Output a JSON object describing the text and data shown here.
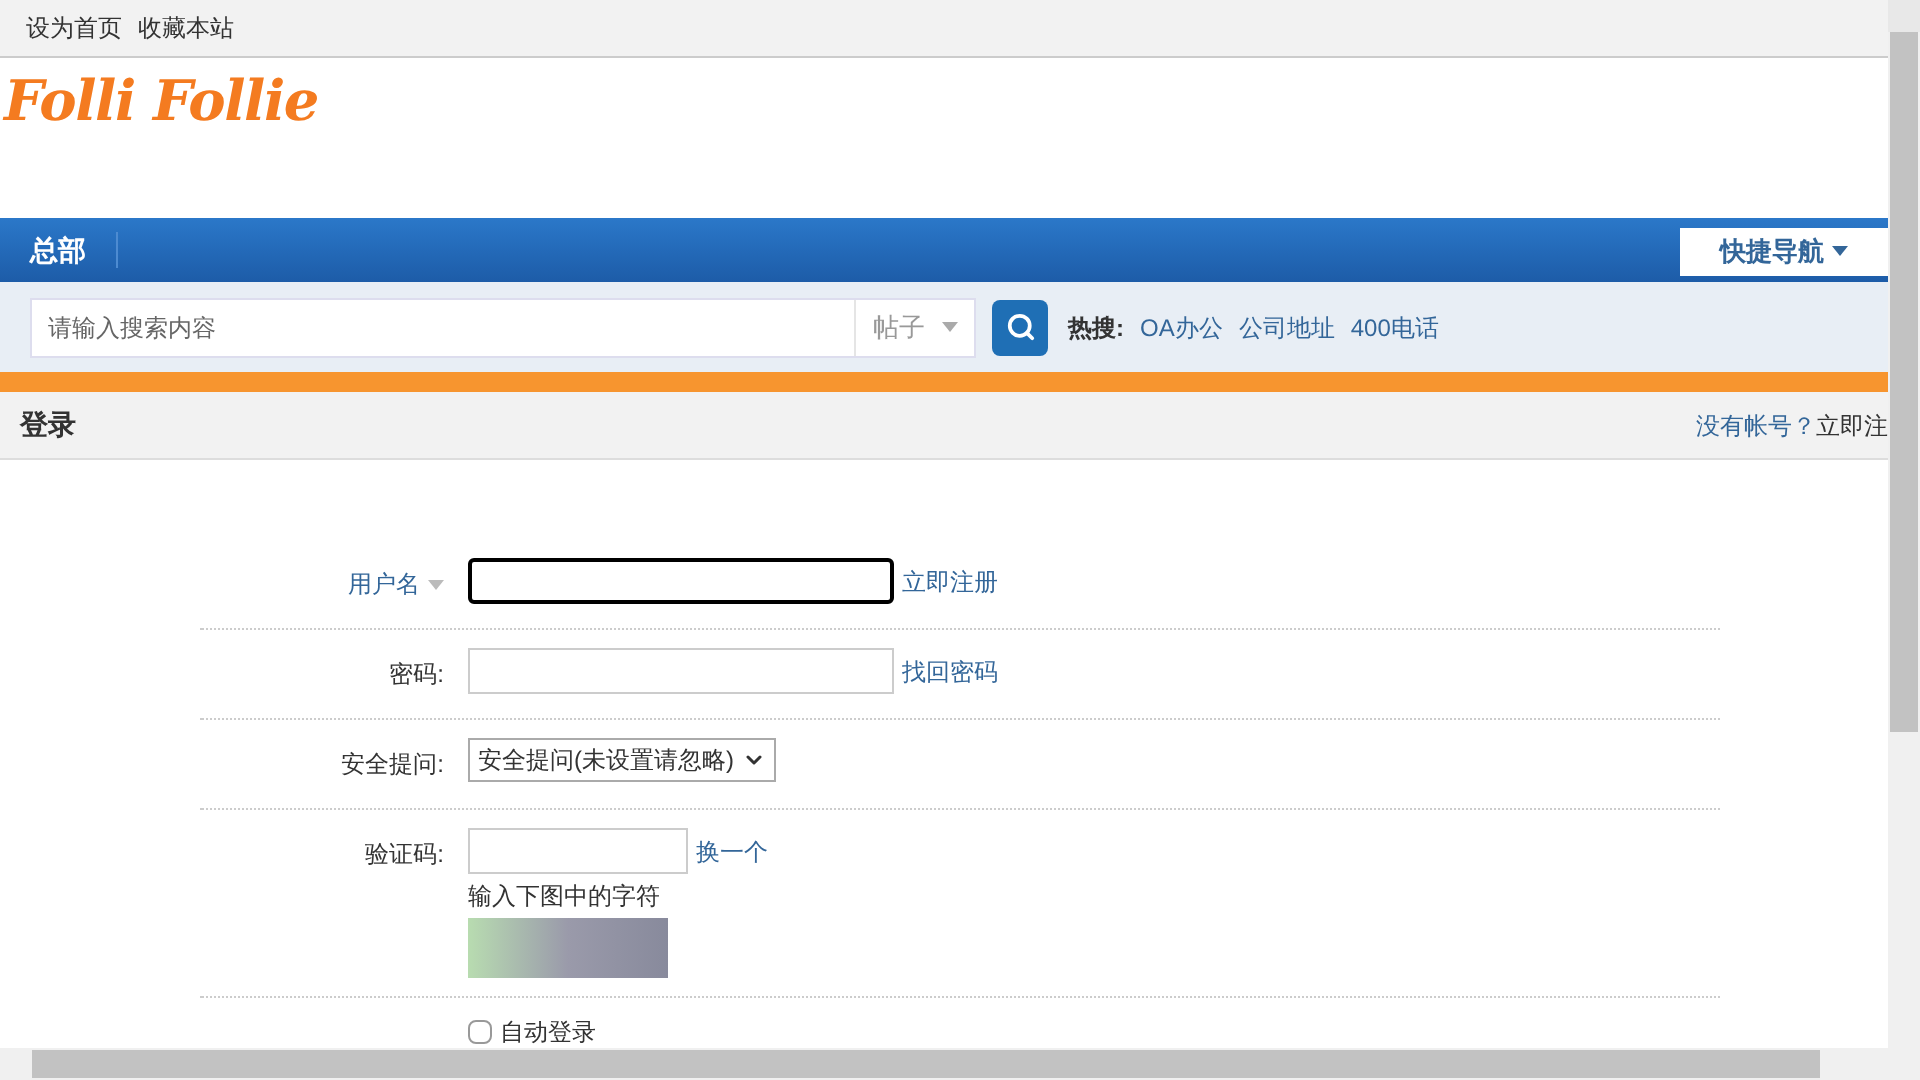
{
  "top_bar": {
    "links": [
      "设为首页",
      "收藏本站"
    ]
  },
  "logo": {
    "text": "Folli Follie"
  },
  "nav": {
    "items": [
      {
        "label": "总部",
        "selected": true
      }
    ],
    "quick_nav": "快捷导航"
  },
  "search": {
    "placeholder": "请输入搜索内容",
    "type": "帖子",
    "hot_label": "热搜:",
    "hot": [
      "OA办公",
      "公司地址",
      "400电话"
    ]
  },
  "login": {
    "title": "登录",
    "no_account": "没有帐号？",
    "register_cut": "立即注",
    "rows": [
      {
        "kind": "input",
        "label": "用户名",
        "label_dropdown": true,
        "focused": true,
        "link": "立即注册"
      },
      {
        "kind": "input",
        "label": "密码:",
        "focused": false,
        "link": "找回密码"
      },
      {
        "kind": "select",
        "label": "安全提问:",
        "value": "安全提问(未设置请忽略)"
      },
      {
        "kind": "captcha",
        "label": "验证码:",
        "link": "换一个",
        "hint": "输入下图中的字符"
      },
      {
        "kind": "checkbox",
        "label": "自动登录",
        "checked": false
      }
    ]
  }
}
